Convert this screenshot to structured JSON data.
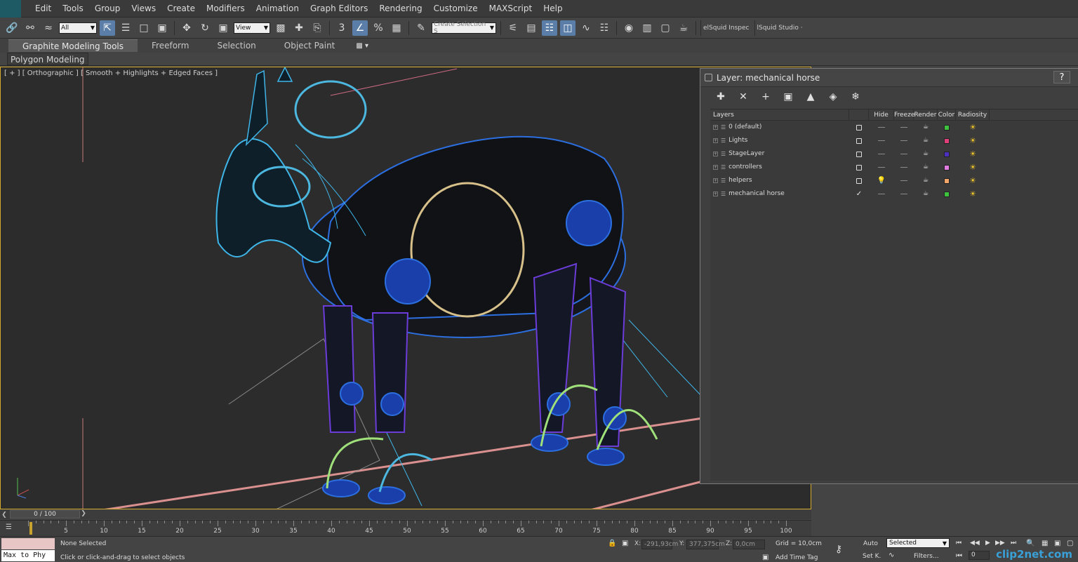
{
  "menu": [
    "Edit",
    "Tools",
    "Group",
    "Views",
    "Create",
    "Modifiers",
    "Animation",
    "Graph Editors",
    "Rendering",
    "Customize",
    "MAXScript",
    "Help"
  ],
  "toolbar": {
    "filter_value": "All",
    "view_value": "View",
    "selection_set_placeholder": "Create Selection S",
    "snap_label": "3",
    "angle_label": "%",
    "plugin1": "elSquid Inspec",
    "plugin2": "lSquid Studio ·"
  },
  "ribbon": {
    "tabs": [
      "Graphite Modeling Tools",
      "Freeform",
      "Selection",
      "Object Paint"
    ],
    "sub_label": "Polygon Modeling"
  },
  "viewport": {
    "label": "[ + ] [ Orthographic ] [ Smooth + Highlights + Edged Faces ]"
  },
  "layer_dialog": {
    "title": "Layer: mechanical horse",
    "help": "?",
    "columns": {
      "layers": "Layers",
      "hide": "Hide",
      "freeze": "Freeze",
      "render": "Render",
      "color": "Color",
      "radiosity": "Radiosity"
    },
    "rows": [
      {
        "name": "0 (default)",
        "color": "#3ec13e",
        "hidden": false,
        "current": false
      },
      {
        "name": "Lights",
        "color": "#e0407a",
        "hidden": false,
        "current": false
      },
      {
        "name": "StageLayer",
        "color": "#4a2fc0",
        "hidden": false,
        "current": false
      },
      {
        "name": "controllers",
        "color": "#e07be0",
        "hidden": false,
        "current": false
      },
      {
        "name": "helpers",
        "color": "#f2a66a",
        "hidden": true,
        "current": false
      },
      {
        "name": "mechanical horse",
        "color": "#3ec13e",
        "hidden": false,
        "current": true
      }
    ]
  },
  "timeline": {
    "position": "0 / 100",
    "ticks": [
      5,
      10,
      15,
      20,
      25,
      30,
      35,
      40,
      45,
      50,
      55,
      60,
      65,
      70,
      75,
      80,
      85,
      90,
      95,
      100
    ]
  },
  "status": {
    "maxscript": "Max to Phy",
    "selection_info": "None Selected",
    "prompt": "Click or click-and-drag to select objects",
    "x_label": "X:",
    "x_value": "-291,93cm",
    "y_label": "Y:",
    "y_value": "377,375cm",
    "z_label": "Z:",
    "z_value": "0,0cm",
    "grid": "Grid = 10,0cm",
    "add_time_tag": "Add Time Tag",
    "auto": "Auto",
    "set_key": "Set K.",
    "selected": "Selected",
    "filters": "Filters...",
    "frame": "0"
  },
  "watermark": "clip2net.com",
  "colors": {
    "viewport_border": "#d2a92a",
    "viewport_bg": "#2c2c2c",
    "wire_blue": "#2c6fe0",
    "wire_cyan": "#3fb5e8",
    "wire_green": "#9fe07a"
  }
}
